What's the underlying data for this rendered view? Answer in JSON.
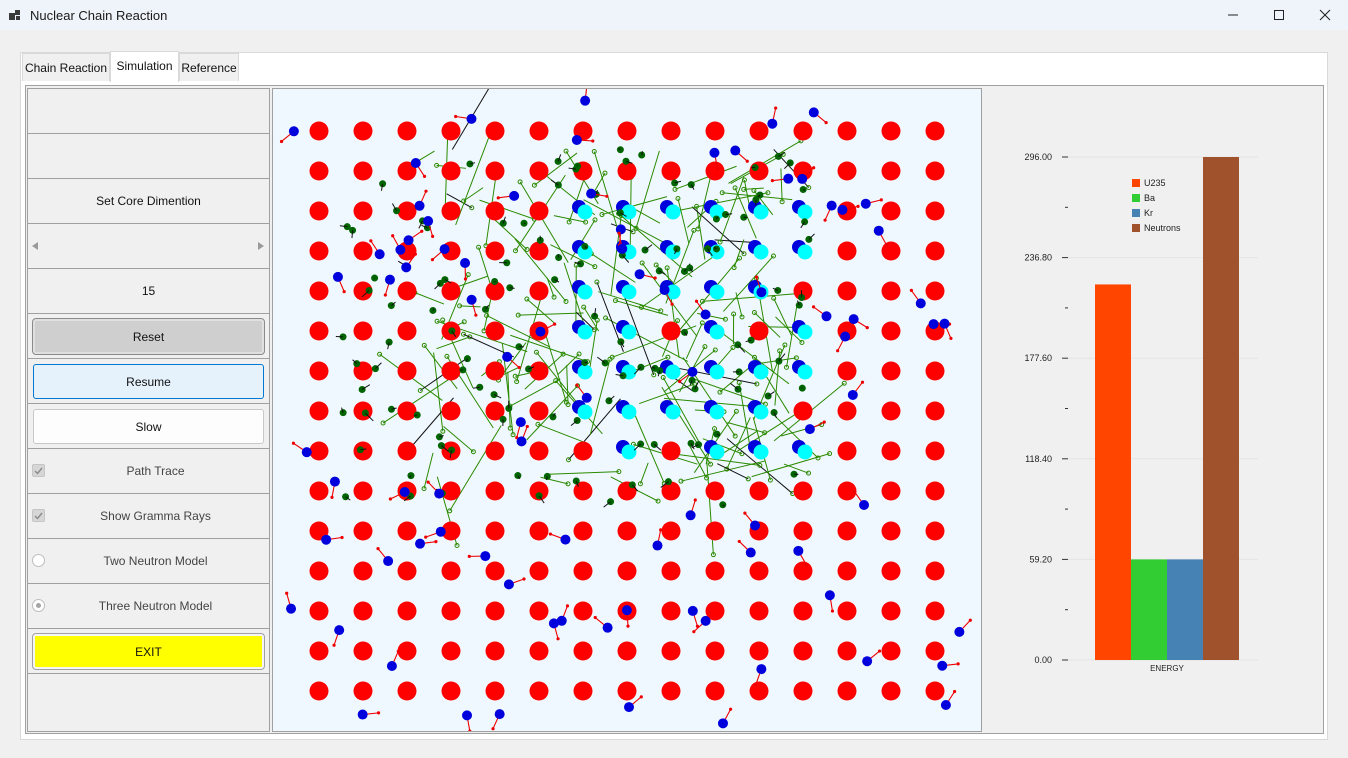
{
  "window": {
    "title": "Nuclear Chain Reaction",
    "controls": [
      "minimize",
      "maximize",
      "close"
    ]
  },
  "tabs": [
    {
      "label": "Chain Reaction",
      "active": false
    },
    {
      "label": "Simulation",
      "active": true
    },
    {
      "label": "Reference",
      "active": false
    }
  ],
  "controls": {
    "set_core_label": "Set Core Dimention",
    "core_value": "15",
    "reset_label": "Reset",
    "resume_label": "Resume",
    "slow_label": "Slow",
    "path_trace_label": "Path Trace",
    "path_trace_checked": true,
    "gamma_rays_label": "Show Gramma Rays",
    "gamma_rays_checked": true,
    "two_neutron_label": "Two Neutron Model",
    "two_neutron_selected": false,
    "three_neutron_label": "Three Neutron Model",
    "three_neutron_selected": true,
    "exit_label": "EXIT"
  },
  "simulation": {
    "grid_size": 15,
    "colors": {
      "u235": "#ff0000",
      "neutron": "#0000dd",
      "fragment": "#00ffff",
      "ba_kr": "#006400",
      "arrow": "#ee0000",
      "gamma": "#2a8a00",
      "background": "#f0f8ff"
    }
  },
  "chart_data": {
    "type": "bar",
    "categories": [
      "ENERGY"
    ],
    "series": [
      {
        "name": "U235",
        "values": [
          221
        ],
        "color": "#ff4500"
      },
      {
        "name": "Ba",
        "values": [
          59.2
        ],
        "color": "#32cd32"
      },
      {
        "name": "Kr",
        "values": [
          59.2
        ],
        "color": "#4682b4"
      },
      {
        "name": "Neutrons",
        "values": [
          296
        ],
        "color": "#a0522d"
      }
    ],
    "yticks": [
      "0.00",
      "59.20",
      "118.40",
      "177.60",
      "236.80",
      "296.00"
    ],
    "ylim": [
      0,
      296
    ],
    "xlabel": "ENERGY",
    "grid": true,
    "legend_position": "top-right"
  }
}
